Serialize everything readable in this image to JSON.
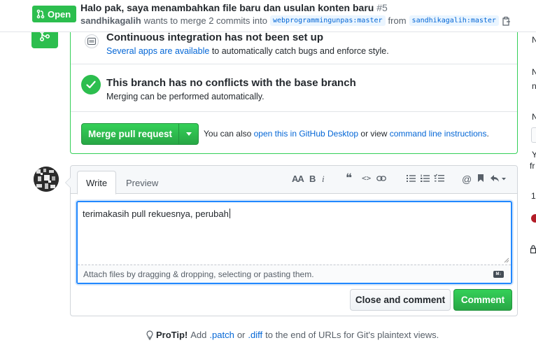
{
  "header": {
    "state": "Open",
    "title": "Halo pak, saya menambahkan file baru dan usulan konten baru",
    "number": "#5",
    "author": "sandhikagalih",
    "meta_text": "wants to merge 2 commits into",
    "base_branch": "webprogrammingunpas:master",
    "from_text": "from",
    "head_branch": "sandhikagalih:master"
  },
  "merge_box": {
    "ci_title": "Continuous integration has not been set up",
    "ci_link": "Several apps are available",
    "ci_text": "to automatically catch bugs and enforce style.",
    "conflict_title": "This branch has no conflicts with the base branch",
    "conflict_text": "Merging can be performed automatically.",
    "merge_button": "Merge pull request",
    "note_prefix": "You can also",
    "note_link1": "open this in GitHub Desktop",
    "note_mid": "or view",
    "note_link2": "command line instructions",
    "note_suffix": "."
  },
  "comment_form": {
    "tabs": [
      "Write",
      "Preview"
    ],
    "text": "terimakasih pull rekuesnya, perubah",
    "attach_text": "Attach files by dragging & dropping, selecting or pasting them.",
    "markdown_badge": "M↓",
    "close_button": "Close and comment",
    "comment_button": "Comment",
    "toolbar": {
      "header": "AA",
      "bold": "B",
      "italic": "i",
      "quote": "❝",
      "code": "<>",
      "mention": "@"
    }
  },
  "protip": {
    "label": "ProTip!",
    "pre": "Add",
    "patch": ".patch",
    "or": "or",
    "diff": ".diff",
    "post": "to the end of URLs for Git's plaintext views."
  },
  "sidebar_clip": {
    "chars": [
      "N",
      "N",
      "n",
      "N",
      "Y",
      "fr",
      "1"
    ]
  },
  "colors": {
    "green": "#2cbe4e",
    "link": "#0366d6",
    "border": "#d1d5da"
  }
}
